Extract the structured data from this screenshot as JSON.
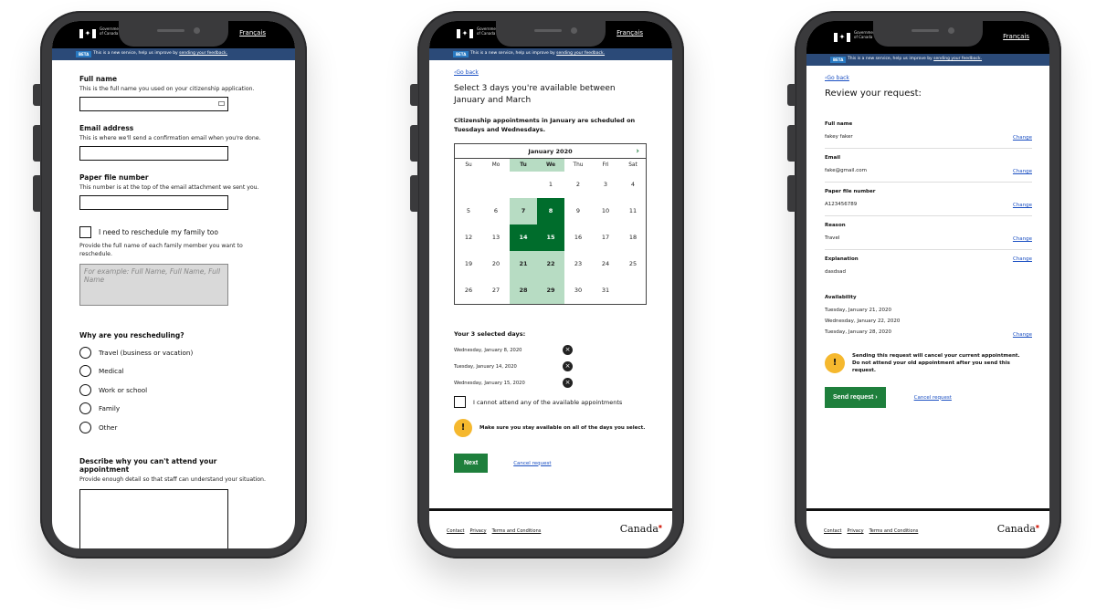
{
  "header": {
    "gov_name": "Government of Canada",
    "language_toggle": "Français",
    "beta_badge": "BETA",
    "beta_text": "This is a new service, help us improve by ",
    "beta_link": "sending your feedback."
  },
  "form": {
    "full_name_label": "Full name",
    "full_name_hint": "This is the full name you used on your citizenship application.",
    "email_label": "Email address",
    "email_hint": "This is where we'll send a confirmation email when you're done.",
    "paper_label": "Paper file number",
    "paper_hint": "This number is at the top of the email attachment we sent you.",
    "family_check_label": "I need to reschedule my family too",
    "family_hint": "Provide the full name of each family member you want to reschedule.",
    "family_placeholder": "For example: Full Name, Full Name, Full Name",
    "reason_label": "Why are you rescheduling?",
    "reasons": [
      "Travel (business or vacation)",
      "Medical",
      "Work or school",
      "Family",
      "Other"
    ],
    "explain_label": "Describe why you can't attend your appointment",
    "explain_hint": "Provide enough detail so that staff can understand your situation."
  },
  "calendar_page": {
    "back_link": "Go back",
    "title": "Select 3 days you're available between January and March",
    "note": "Citizenship appointments in January are scheduled on Tuesdays and Wednesdays.",
    "month": "January 2020",
    "weekdays": [
      "Su",
      "Mo",
      "Tu",
      "We",
      "Thu",
      "Fri",
      "Sat"
    ],
    "weeks": [
      [
        "",
        "",
        "",
        "1",
        "2",
        "3",
        "4"
      ],
      [
        "5",
        "6",
        "7",
        "8",
        "9",
        "10",
        "11"
      ],
      [
        "12",
        "13",
        "14",
        "15",
        "16",
        "17",
        "18"
      ],
      [
        "19",
        "20",
        "21",
        "22",
        "23",
        "24",
        "25"
      ],
      [
        "26",
        "27",
        "28",
        "29",
        "30",
        "31",
        ""
      ]
    ],
    "available_days": [
      "7",
      "8",
      "14",
      "15",
      "21",
      "22",
      "28",
      "29"
    ],
    "selected_days_in_grid": [
      "8",
      "14",
      "15"
    ],
    "selected_title": "Your 3 selected days:",
    "selected_days": [
      "Wednesday, January 8, 2020",
      "Tuesday, January 14, 2020",
      "Wednesday, January 15, 2020"
    ],
    "cannot_attend": "I cannot attend any of the available appointments",
    "warning": "Make sure you stay available on all of the days you select.",
    "next_button": "Next",
    "cancel_link": "Cancel request"
  },
  "review_page": {
    "back_link": "Go back",
    "title": "Review your request:",
    "items": [
      {
        "label": "Full name",
        "value": "fakey faker"
      },
      {
        "label": "Email",
        "value": "fake@gmail.com"
      },
      {
        "label": "Paper file number",
        "value": "A123456789"
      },
      {
        "label": "Reason",
        "value": "Travel"
      },
      {
        "label": "Explanation",
        "value": "dasdsad"
      }
    ],
    "availability_label": "Availability",
    "availability": [
      "Tuesday, January 21, 2020",
      "Wednesday, January 22, 2020",
      "Tuesday, January 28, 2020"
    ],
    "change_link": "Change",
    "warning": "Sending this request will cancel your current appointment. Do not attend your old appointment after you send this request.",
    "send_button": "Send request ›",
    "cancel_link": "Cancel request"
  },
  "footer": {
    "links": [
      "Contact",
      "Privacy",
      "Terms and Conditions"
    ],
    "wordmark": "Canada"
  },
  "colors": {
    "gov_green": "#1e7f3c",
    "selected_day": "#006d2c",
    "available_day": "#b7dcc3",
    "beta_bar": "#2b4a78",
    "warning": "#f5b82e",
    "link": "#1a4fc2"
  }
}
